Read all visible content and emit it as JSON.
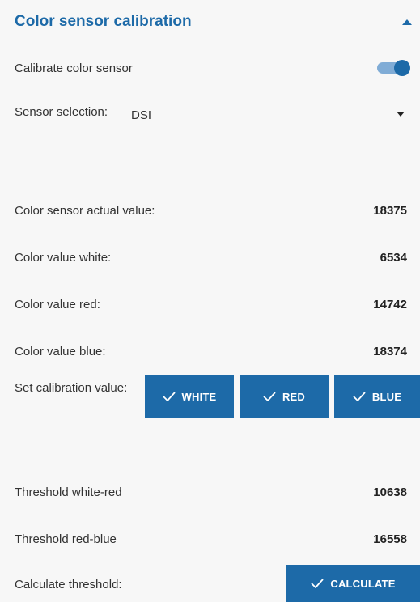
{
  "header": {
    "title": "Color sensor calibration",
    "collapse_icon": "chevron-up-icon"
  },
  "calibrate": {
    "label": "Calibrate color sensor",
    "enabled": true
  },
  "sensor_selection": {
    "label": "Sensor selection:",
    "value": "DSI"
  },
  "readings": [
    {
      "label": "Color sensor actual value:",
      "value": "18375"
    },
    {
      "label": "Color value white:",
      "value": "6534"
    },
    {
      "label": "Color value red:",
      "value": "14742"
    },
    {
      "label": "Color value blue:",
      "value": "18374"
    }
  ],
  "set_calibration": {
    "label": "Set calibration value:",
    "buttons": [
      {
        "label": "WHITE",
        "icon": "check-icon"
      },
      {
        "label": "RED",
        "icon": "check-icon"
      },
      {
        "label": "BLUE",
        "icon": "check-icon"
      }
    ]
  },
  "thresholds": [
    {
      "label": "Threshold white-red",
      "value": "10638"
    },
    {
      "label": "Threshold red-blue",
      "value": "16558"
    }
  ],
  "calculate": {
    "label": "Calculate threshold:",
    "button_label": "CALCULATE",
    "icon": "check-icon"
  },
  "colors": {
    "accent": "#1d6aa8",
    "toggle_track": "#80acd6",
    "background": "#f7f7f7"
  }
}
